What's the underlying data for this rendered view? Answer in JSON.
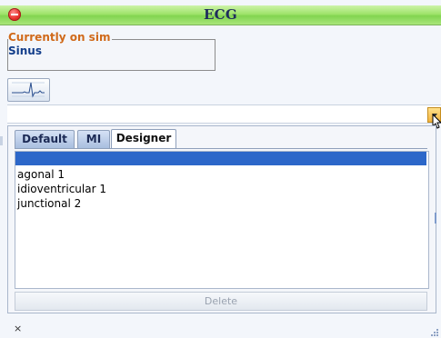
{
  "window": {
    "title": "ECG"
  },
  "current": {
    "legend": "Currently on sim",
    "value": "Sinus"
  },
  "tabs": [
    {
      "label": "Default",
      "active": false
    },
    {
      "label": "MI",
      "active": false
    },
    {
      "label": "Designer",
      "active": true
    }
  ],
  "list": {
    "items": [
      "agonal 1",
      "idioventricular 1",
      "junctional 2"
    ]
  },
  "buttons": {
    "delete_label": "Delete"
  },
  "status": {
    "close_glyph": "×"
  },
  "colors": {
    "title_bar": "#9fe36a",
    "legend": "#d06a1a",
    "selection": "#2c67c9"
  }
}
